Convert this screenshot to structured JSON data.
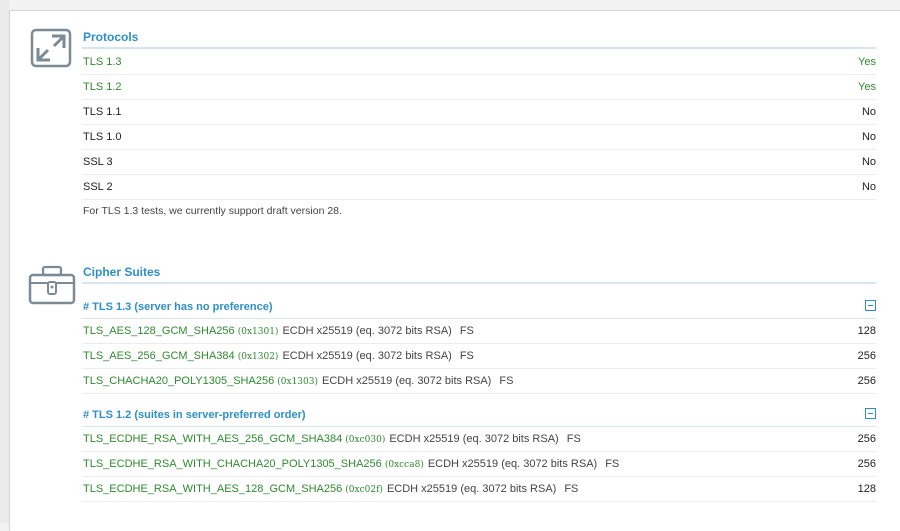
{
  "protocols": {
    "title": "Protocols",
    "rows": [
      {
        "name": "TLS 1.3",
        "value": "Yes"
      },
      {
        "name": "TLS 1.2",
        "value": "Yes"
      },
      {
        "name": "TLS 1.1",
        "value": "No"
      },
      {
        "name": "TLS 1.0",
        "value": "No"
      },
      {
        "name": "SSL 3",
        "value": "No"
      },
      {
        "name": "SSL 2",
        "value": "No"
      }
    ],
    "note": "For TLS 1.3 tests, we currently support draft version 28."
  },
  "cipher_suites": {
    "title": "Cipher Suites",
    "groups": [
      {
        "header": "# TLS 1.3 (server has no preference)",
        "suites": [
          {
            "name": "TLS_AES_128_GCM_SHA256",
            "code": "(0x1301)",
            "info": "ECDH x25519 (eq. 3072 bits RSA)",
            "fs": "FS",
            "bits": "128"
          },
          {
            "name": "TLS_AES_256_GCM_SHA384",
            "code": "(0x1302)",
            "info": "ECDH x25519 (eq. 3072 bits RSA)",
            "fs": "FS",
            "bits": "256"
          },
          {
            "name": "TLS_CHACHA20_POLY1305_SHA256",
            "code": "(0x1303)",
            "info": "ECDH x25519 (eq. 3072 bits RSA)",
            "fs": "FS",
            "bits": "256"
          }
        ]
      },
      {
        "header": "# TLS 1.2 (suites in server-preferred order)",
        "suites": [
          {
            "name": "TLS_ECDHE_RSA_WITH_AES_256_GCM_SHA384",
            "code": "(0xc030)",
            "info": "ECDH x25519 (eq. 3072 bits RSA)",
            "fs": "FS",
            "bits": "256"
          },
          {
            "name": "TLS_ECDHE_RSA_WITH_CHACHA20_POLY1305_SHA256",
            "code": "(0xcca8)",
            "info": "ECDH x25519 (eq. 3072 bits RSA)",
            "fs": "FS",
            "bits": "256"
          },
          {
            "name": "TLS_ECDHE_RSA_WITH_AES_128_GCM_SHA256",
            "code": "(0xc02f)",
            "info": "ECDH x25519 (eq. 3072 bits RSA)",
            "fs": "FS",
            "bits": "128"
          }
        ]
      }
    ]
  },
  "icons": {
    "protocols": "expand-arrows-icon",
    "cipher_suites": "toolbox-icon"
  },
  "colors": {
    "accent": "#2e8fc6",
    "green": "#2f8a2f"
  }
}
